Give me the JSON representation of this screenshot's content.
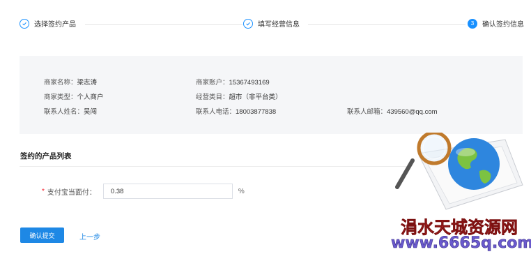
{
  "steps": [
    {
      "label": "选择签约产品",
      "status": "done"
    },
    {
      "label": "填写经营信息",
      "status": "done"
    },
    {
      "label": "确认签约信息",
      "status": "active",
      "number": "3"
    }
  ],
  "info": {
    "merchant_name": {
      "label": "商家名称：",
      "value": "梁志涛"
    },
    "merchant_account": {
      "label": "商家账户：",
      "value": "15367493169"
    },
    "merchant_type": {
      "label": "商家类型：",
      "value": "个人商户"
    },
    "business_category": {
      "label": "经营类目：",
      "value": "超市（非平台类）"
    },
    "contact_name": {
      "label": "联系人姓名：",
      "value": "吴闯"
    },
    "contact_phone": {
      "label": "联系人电话：",
      "value": "18003877838"
    },
    "contact_email": {
      "label": "联系人邮箱：",
      "value": "439560@qq.com"
    }
  },
  "product_list": {
    "title": "签约的产品列表",
    "required_mark": "*",
    "rate_label": "支付宝当面付：",
    "rate_value": "0.38",
    "rate_unit": "%"
  },
  "buttons": {
    "submit": "确认提交",
    "prev": "上一步"
  },
  "watermark": {
    "title": "涓水天城资源网",
    "url": "www.6665q.com"
  },
  "colors": {
    "accent": "#1890ff",
    "panel_bg": "#f5f6f8",
    "required": "#f5222d"
  }
}
